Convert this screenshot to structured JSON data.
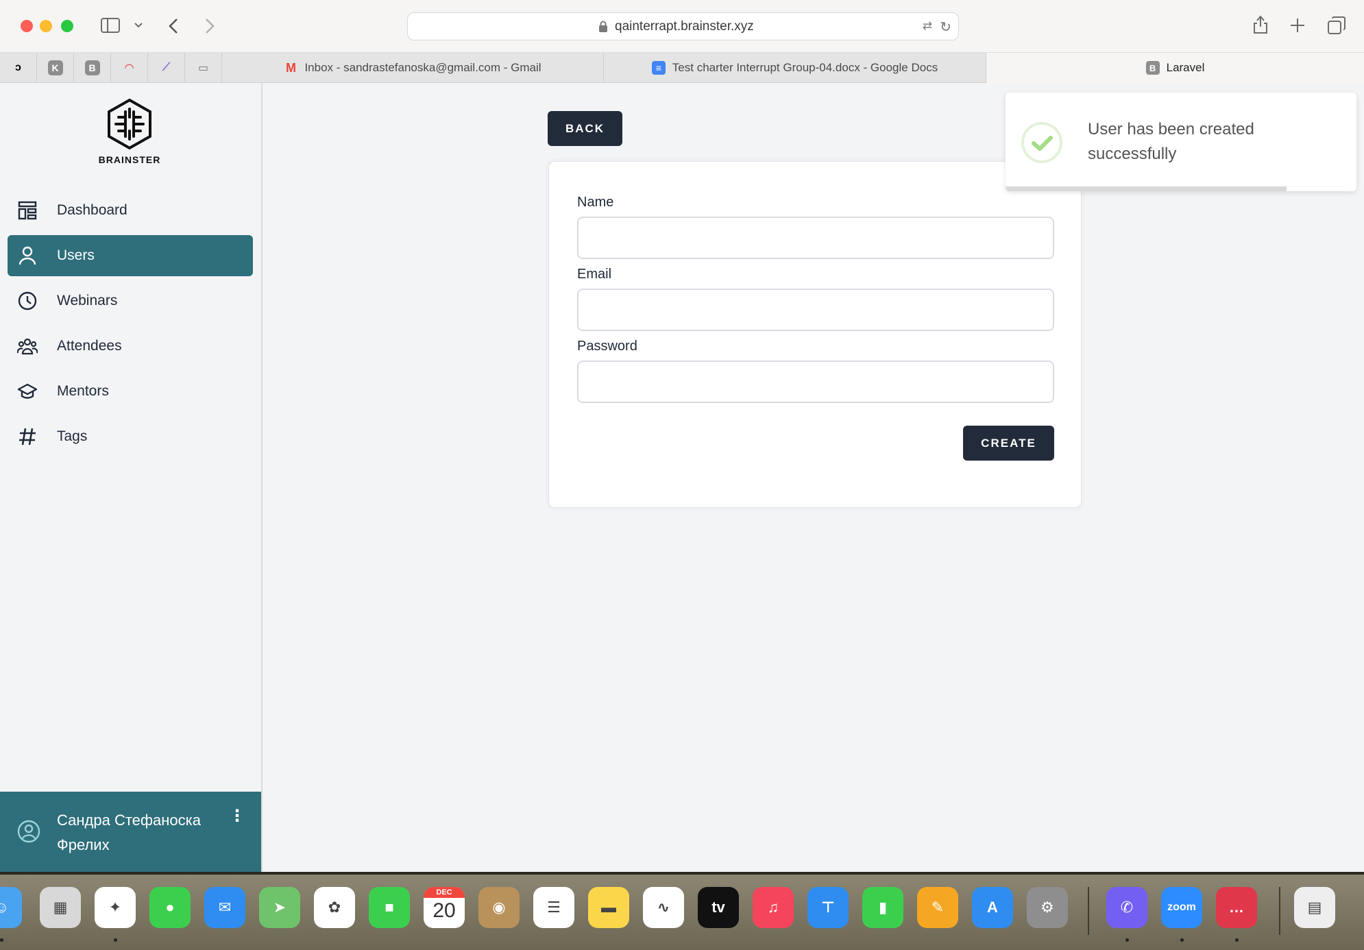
{
  "browser": {
    "url": "qainterrapt.brainster.xyz",
    "pinned_tabs": [
      {
        "icon": "pinned-tab-d-icon",
        "glyph": "ↄ"
      },
      {
        "icon": "pinned-tab-k-icon",
        "glyph": "K"
      },
      {
        "icon": "pinned-tab-b-icon",
        "glyph": "B"
      },
      {
        "icon": "pinned-tab-speedometer-icon",
        "glyph": "◠"
      },
      {
        "icon": "pinned-tab-feather-icon",
        "glyph": "⟋"
      },
      {
        "icon": "pinned-tab-monitor-icon",
        "glyph": "▭"
      }
    ],
    "tabs": [
      {
        "label": "Inbox - sandrastefanoska@gmail.com - Gmail",
        "icon": "gmail-icon",
        "fav": "M",
        "color": "#ea4335"
      },
      {
        "label": "Test charter Interrupt Group-04.docx - Google Docs",
        "icon": "google-docs-icon",
        "fav": "≡",
        "color": "#4285f4"
      },
      {
        "label": "Laravel",
        "icon": "laravel-b-icon",
        "fav": "B",
        "color": "#8d8d8d",
        "active": true
      }
    ]
  },
  "sidebar": {
    "brand": "BRAINSTER",
    "items": [
      {
        "label": "Dashboard",
        "icon": "dashboard-icon"
      },
      {
        "label": "Users",
        "icon": "user-icon",
        "active": true
      },
      {
        "label": "Webinars",
        "icon": "clock-icon"
      },
      {
        "label": "Attendees",
        "icon": "group-icon"
      },
      {
        "label": "Mentors",
        "icon": "graduation-cap-icon"
      },
      {
        "label": "Tags",
        "icon": "hashtag-icon"
      }
    ],
    "user": {
      "name": "Сандра Стефаноска Фрелих"
    }
  },
  "form": {
    "back_label": "BACK",
    "name_label": "Name",
    "name_value": "",
    "email_label": "Email",
    "email_value": "",
    "password_label": "Password",
    "password_value": "",
    "create_label": "CREATE"
  },
  "toast": {
    "message": "User has been created successfully",
    "progress": 0.8
  },
  "dock": {
    "apps": [
      {
        "name": "finder-icon",
        "color": "#4aa3f0",
        "glyph": "☺"
      },
      {
        "name": "launchpad-icon",
        "color": "#d8d8d8",
        "glyph": "▦"
      },
      {
        "name": "safari-icon",
        "color": "#ffffff",
        "glyph": "✦"
      },
      {
        "name": "messages-icon",
        "color": "#3ccf4e",
        "glyph": "●"
      },
      {
        "name": "mail-icon",
        "color": "#2f8cf0",
        "glyph": "✉"
      },
      {
        "name": "maps-icon",
        "color": "#6fc36a",
        "glyph": "➤"
      },
      {
        "name": "photos-icon",
        "color": "#ffffff",
        "glyph": "✿"
      },
      {
        "name": "facetime-icon",
        "color": "#3ccf4e",
        "glyph": "■"
      },
      {
        "name": "calendar-icon",
        "color": "#ffffff",
        "glyph": "20"
      },
      {
        "name": "contacts-icon",
        "color": "#b8925a",
        "glyph": "◉"
      },
      {
        "name": "reminders-icon",
        "color": "#ffffff",
        "glyph": "☰"
      },
      {
        "name": "notes-icon",
        "color": "#fbd64a",
        "glyph": "▬"
      },
      {
        "name": "freeform-icon",
        "color": "#ffffff",
        "glyph": "∿"
      },
      {
        "name": "apple-tv-icon",
        "color": "#111111",
        "glyph": "tv"
      },
      {
        "name": "music-icon",
        "color": "#f5455c",
        "glyph": "♫"
      },
      {
        "name": "keynote-icon",
        "color": "#2f8cf0",
        "glyph": "⊤"
      },
      {
        "name": "numbers-icon",
        "color": "#3ccf4e",
        "glyph": "▮"
      },
      {
        "name": "pages-icon",
        "color": "#f5a623",
        "glyph": "✎"
      },
      {
        "name": "app-store-icon",
        "color": "#2f8cf0",
        "glyph": "A"
      },
      {
        "name": "system-settings-icon",
        "color": "#8e8e8e",
        "glyph": "⚙"
      },
      {
        "name": "viber-icon",
        "color": "#7360f2",
        "glyph": "✆"
      },
      {
        "name": "zoom-icon",
        "color": "#2d8cff",
        "glyph": "zoom"
      },
      {
        "name": "rocketchat-icon",
        "color": "#e0374a",
        "glyph": "…"
      },
      {
        "name": "xlsx-file-icon",
        "color": "#eeeeee",
        "glyph": "▤"
      }
    ],
    "calendar_month": "DEC"
  }
}
